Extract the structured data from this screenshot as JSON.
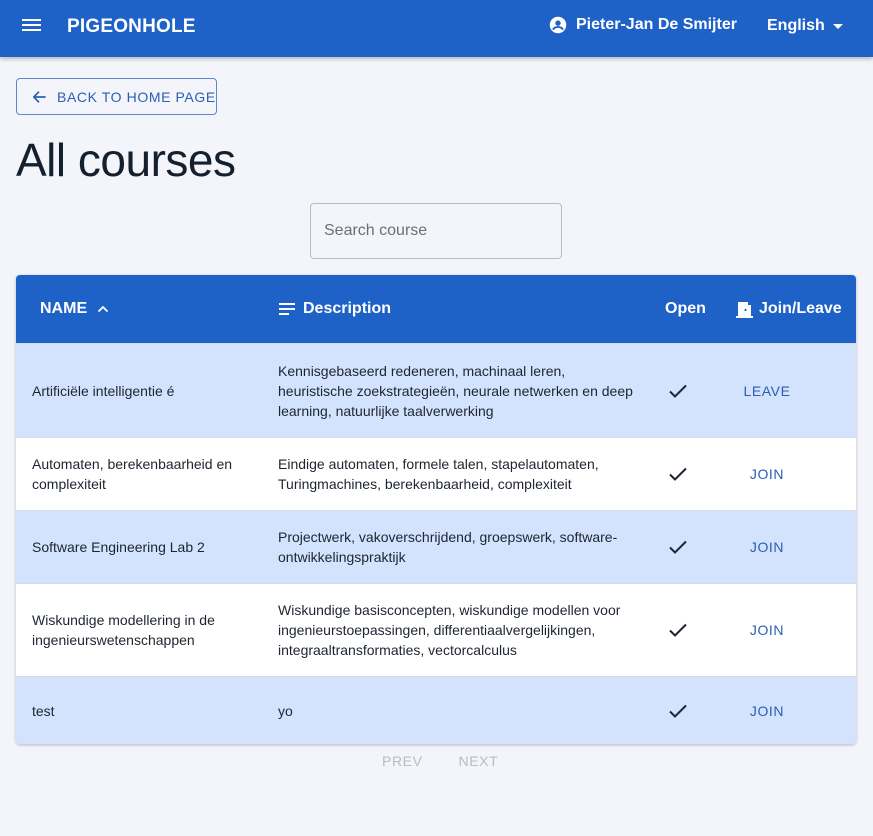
{
  "app": {
    "brand": "PIGEONHOLE",
    "user_name": "Pieter-Jan De Smijter",
    "language": "English"
  },
  "back_button": {
    "label": "BACK TO HOME PAGE"
  },
  "page": {
    "title": "All courses"
  },
  "search": {
    "placeholder": "Search course",
    "value": ""
  },
  "table": {
    "columns": {
      "name": "NAME",
      "description": "Description",
      "open": "Open",
      "join_leave": "Join/Leave"
    },
    "sort": {
      "column": "name",
      "direction": "ascending"
    },
    "rows": [
      {
        "name": "Artificiële intelligentie é",
        "description": "Kennisgebaseerd redeneren, machinaal leren, heuristische zoekstrategieën, neurale netwerken en deep learning, natuurlijke taalverwerking",
        "open": true,
        "action": "LEAVE"
      },
      {
        "name": "Automaten, berekenbaarheid en complexiteit",
        "description": "Eindige automaten, formele talen, stapelautomaten, Turingmachines, berekenbaarheid, complexiteit",
        "open": true,
        "action": "JOIN"
      },
      {
        "name": "Software Engineering Lab 2",
        "description": "Projectwerk, vakoverschrijdend, groepswerk, software-ontwikkelingspraktijk",
        "open": true,
        "action": "JOIN"
      },
      {
        "name": "Wiskundige modellering in de ingenieurswetenschappen",
        "description": "Wiskundige basisconcepten, wiskundige modellen voor ingenieurstoepassingen, differentiaalvergelijkingen, integraaltransformaties, vectorcalculus",
        "open": true,
        "action": "JOIN"
      },
      {
        "name": "test",
        "description": "yo",
        "open": true,
        "action": "JOIN"
      }
    ]
  },
  "pagination": {
    "prev": "PREV",
    "next": "NEXT",
    "prev_enabled": false,
    "next_enabled": false
  },
  "colors": {
    "primary": "#1e62c8",
    "row_highlight": "#d3e3fd",
    "background": "#f4f4fb",
    "link": "#2a5fb5",
    "disabled": "#b8bcc5"
  },
  "icons": {
    "menu": "menu-icon",
    "account": "account-circle-icon",
    "language_caret": "caret-down-icon",
    "back": "arrow-left-icon",
    "sort": "chevron-up-icon",
    "description": "notes-icon",
    "join_leave": "door-open-icon",
    "open": "check-icon"
  }
}
